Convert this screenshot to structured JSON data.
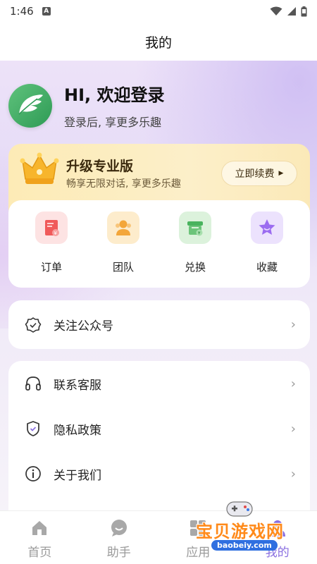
{
  "status_bar": {
    "time": "1:46",
    "notification_glyph": "A"
  },
  "header": {
    "title": "我的"
  },
  "profile": {
    "greeting": "HI, 欢迎登录",
    "hint": "登录后, 享更多乐趣",
    "avatar_icon": "leaf-logo-icon"
  },
  "vip": {
    "title": "升级专业版",
    "subtitle": "畅享无限对话, 享更多乐趣",
    "button_label": "立即续费",
    "icon": "crown-icon"
  },
  "quick_actions": [
    {
      "label": "订单",
      "icon": "order-icon",
      "color": "#f05a5a"
    },
    {
      "label": "团队",
      "icon": "team-icon",
      "color": "#f3a63a"
    },
    {
      "label": "兑换",
      "icon": "redeem-icon",
      "color": "#49b35e"
    },
    {
      "label": "收藏",
      "icon": "favorite-star-icon",
      "color": "#9b6cf0"
    }
  ],
  "menu_group_1": [
    {
      "label": "关注公众号",
      "icon": "verified-badge-icon"
    }
  ],
  "menu_group_2": [
    {
      "label": "联系客服",
      "icon": "headset-icon"
    },
    {
      "label": "隐私政策",
      "icon": "shield-icon"
    },
    {
      "label": "关于我们",
      "icon": "info-icon"
    }
  ],
  "bottom_nav": [
    {
      "label": "首页",
      "icon": "home-icon",
      "active": false
    },
    {
      "label": "助手",
      "icon": "chat-bubble-icon",
      "active": false
    },
    {
      "label": "应用",
      "icon": "apps-icon",
      "active": false
    },
    {
      "label": "我的",
      "icon": "profile-icon",
      "active": true
    }
  ],
  "watermark": {
    "text": "宝贝游戏网",
    "url": "baobeiy.com"
  },
  "colors": {
    "accent": "#8a6fe0",
    "vip_gold": "#fdebb6",
    "watermark_orange": "#ff8a1a"
  }
}
